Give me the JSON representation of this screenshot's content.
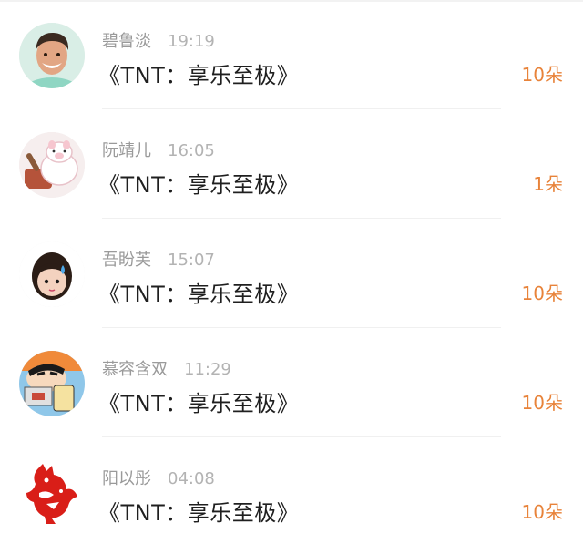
{
  "colors": {
    "amount": "#e8833a",
    "name": "#9a9a9a",
    "title": "#1f1f1f"
  },
  "records": [
    {
      "name": "碧鲁淡",
      "time": "19:19",
      "title": "《TNT：享乐至极》",
      "amount": "10朵",
      "avatar": "man-photo-avatar"
    },
    {
      "name": "阮靖儿",
      "time": "16:05",
      "title": "《TNT：享乐至极》",
      "amount": "1朵",
      "avatar": "cartoon-pig-avatar"
    },
    {
      "name": "吾盼芙",
      "time": "15:07",
      "title": "《TNT：享乐至极》",
      "amount": "10朵",
      "avatar": "child-sweat-avatar"
    },
    {
      "name": "慕容含双",
      "time": "11:29",
      "title": "《TNT：享乐至极》",
      "amount": "10朵",
      "avatar": "crayon-shin-chan-avatar"
    },
    {
      "name": "阳以彤",
      "time": "04:08",
      "title": "《TNT：享乐至极》",
      "amount": "10朵",
      "avatar": "paper-cut-rooster-avatar"
    }
  ]
}
